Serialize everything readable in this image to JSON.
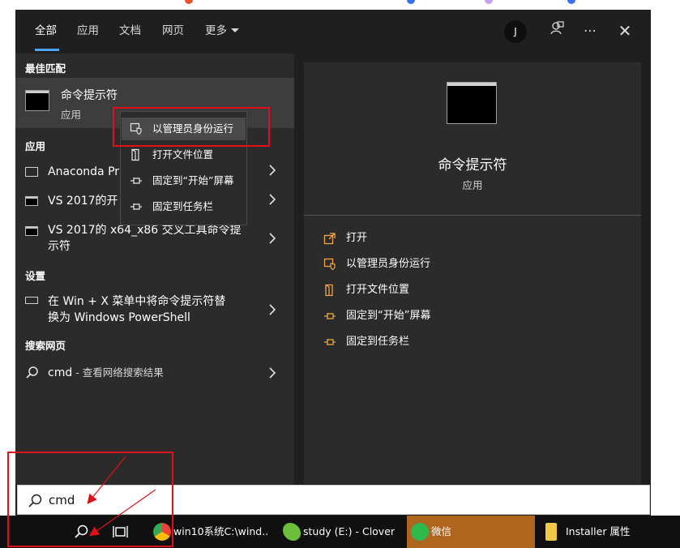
{
  "tabs": [
    {
      "label": "全部",
      "active": true
    },
    {
      "label": "应用",
      "active": false
    },
    {
      "label": "文档",
      "active": false
    },
    {
      "label": "网页",
      "active": false
    },
    {
      "label": "更多",
      "active": false
    }
  ],
  "user_initial": "J",
  "sections": {
    "best_match": "最佳匹配",
    "apps": "应用",
    "settings": "设置",
    "web": "搜索网页"
  },
  "best_match": {
    "title": "命令提示符",
    "subtitle": "应用"
  },
  "apps": [
    {
      "label": "Anaconda Pr",
      "icon": "keyboard-icon"
    },
    {
      "label": "VS 2017的开",
      "icon": "terminal-icon"
    },
    {
      "label": "VS 2017的 x64_x86 交叉工具命令提",
      "label_line2": "示符",
      "icon": "terminal-icon"
    }
  ],
  "settings_item": {
    "line1": "在 Win + X 菜单中将命令提示符替",
    "line2": "换为 Windows PowerShell"
  },
  "web_item": {
    "query": "cmd",
    "suffix": " - 查看网络搜索结果"
  },
  "context_menu": [
    {
      "label": "以管理员身份运行",
      "icon": "shield-icon",
      "highlighted": true
    },
    {
      "label": "打开文件位置",
      "icon": "folder-icon",
      "highlighted": false
    },
    {
      "label": "固定到“开始”屏幕",
      "icon": "pin-icon",
      "highlighted": false
    },
    {
      "label": "固定到任务栏",
      "icon": "pin-icon",
      "highlighted": false
    }
  ],
  "preview": {
    "title": "命令提示符",
    "subtitle": "应用",
    "actions": [
      {
        "label": "打开",
        "icon": "open-icon"
      },
      {
        "label": "以管理员身份运行",
        "icon": "shield-icon"
      },
      {
        "label": "打开文件位置",
        "icon": "folder-icon"
      },
      {
        "label": "固定到“开始”屏幕",
        "icon": "pin-icon"
      },
      {
        "label": "固定到任务栏",
        "icon": "pin-icon"
      }
    ]
  },
  "search": {
    "value": "cmd"
  },
  "taskbar": [
    {
      "label": "win10系统C:\\wind...",
      "icon": "chrome-icon"
    },
    {
      "label": "study (E:) - Clover",
      "icon": "clover-icon"
    },
    {
      "label": "微信",
      "icon": "wechat-icon"
    },
    {
      "label": "Installer 属性",
      "icon": "folder-icon"
    }
  ],
  "colors": {
    "accent": "#4fa3f7",
    "annotation": "#e0101a",
    "action_icon": "#f0a54a",
    "wechat_bg": "#b0651e"
  }
}
